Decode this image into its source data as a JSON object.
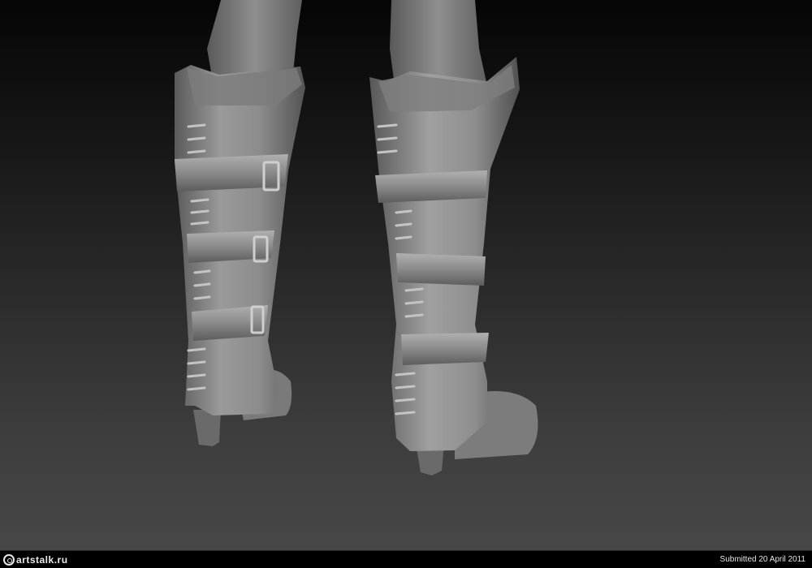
{
  "scene": {
    "subject": "boots-sculpt",
    "colors": {
      "background_top": "#050505",
      "background_bottom": "#474747",
      "clay": "#8a8a8a",
      "clay_light": "#a9a9a9",
      "clay_dark": "#4e4e4e"
    }
  },
  "footer": {
    "site_logo": "artstalk.ru",
    "submitted": "Submitted 20 April 2011"
  }
}
